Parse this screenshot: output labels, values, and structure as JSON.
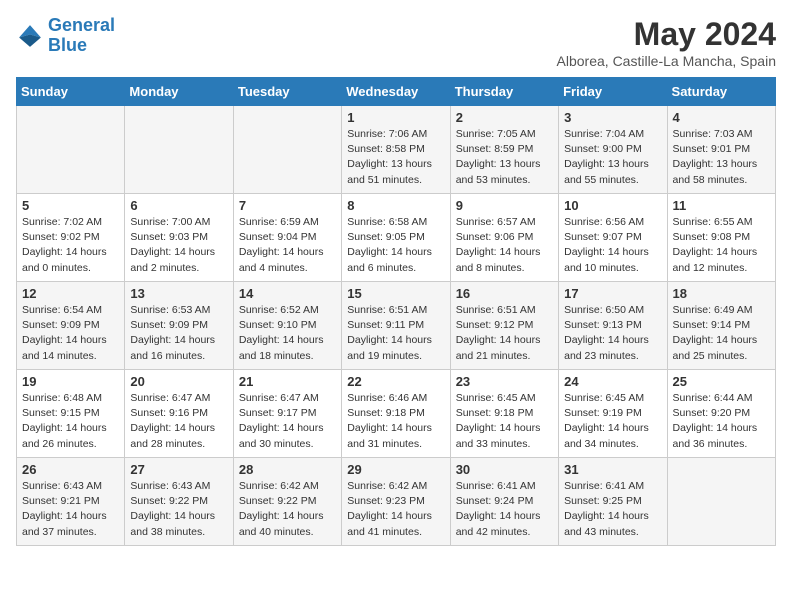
{
  "header": {
    "logo_line1": "General",
    "logo_line2": "Blue",
    "month_title": "May 2024",
    "location": "Alborea, Castille-La Mancha, Spain"
  },
  "days_of_week": [
    "Sunday",
    "Monday",
    "Tuesday",
    "Wednesday",
    "Thursday",
    "Friday",
    "Saturday"
  ],
  "weeks": [
    [
      {
        "day": "",
        "info": ""
      },
      {
        "day": "",
        "info": ""
      },
      {
        "day": "",
        "info": ""
      },
      {
        "day": "1",
        "info": "Sunrise: 7:06 AM\nSunset: 8:58 PM\nDaylight: 13 hours\nand 51 minutes."
      },
      {
        "day": "2",
        "info": "Sunrise: 7:05 AM\nSunset: 8:59 PM\nDaylight: 13 hours\nand 53 minutes."
      },
      {
        "day": "3",
        "info": "Sunrise: 7:04 AM\nSunset: 9:00 PM\nDaylight: 13 hours\nand 55 minutes."
      },
      {
        "day": "4",
        "info": "Sunrise: 7:03 AM\nSunset: 9:01 PM\nDaylight: 13 hours\nand 58 minutes."
      }
    ],
    [
      {
        "day": "5",
        "info": "Sunrise: 7:02 AM\nSunset: 9:02 PM\nDaylight: 14 hours\nand 0 minutes."
      },
      {
        "day": "6",
        "info": "Sunrise: 7:00 AM\nSunset: 9:03 PM\nDaylight: 14 hours\nand 2 minutes."
      },
      {
        "day": "7",
        "info": "Sunrise: 6:59 AM\nSunset: 9:04 PM\nDaylight: 14 hours\nand 4 minutes."
      },
      {
        "day": "8",
        "info": "Sunrise: 6:58 AM\nSunset: 9:05 PM\nDaylight: 14 hours\nand 6 minutes."
      },
      {
        "day": "9",
        "info": "Sunrise: 6:57 AM\nSunset: 9:06 PM\nDaylight: 14 hours\nand 8 minutes."
      },
      {
        "day": "10",
        "info": "Sunrise: 6:56 AM\nSunset: 9:07 PM\nDaylight: 14 hours\nand 10 minutes."
      },
      {
        "day": "11",
        "info": "Sunrise: 6:55 AM\nSunset: 9:08 PM\nDaylight: 14 hours\nand 12 minutes."
      }
    ],
    [
      {
        "day": "12",
        "info": "Sunrise: 6:54 AM\nSunset: 9:09 PM\nDaylight: 14 hours\nand 14 minutes."
      },
      {
        "day": "13",
        "info": "Sunrise: 6:53 AM\nSunset: 9:09 PM\nDaylight: 14 hours\nand 16 minutes."
      },
      {
        "day": "14",
        "info": "Sunrise: 6:52 AM\nSunset: 9:10 PM\nDaylight: 14 hours\nand 18 minutes."
      },
      {
        "day": "15",
        "info": "Sunrise: 6:51 AM\nSunset: 9:11 PM\nDaylight: 14 hours\nand 19 minutes."
      },
      {
        "day": "16",
        "info": "Sunrise: 6:51 AM\nSunset: 9:12 PM\nDaylight: 14 hours\nand 21 minutes."
      },
      {
        "day": "17",
        "info": "Sunrise: 6:50 AM\nSunset: 9:13 PM\nDaylight: 14 hours\nand 23 minutes."
      },
      {
        "day": "18",
        "info": "Sunrise: 6:49 AM\nSunset: 9:14 PM\nDaylight: 14 hours\nand 25 minutes."
      }
    ],
    [
      {
        "day": "19",
        "info": "Sunrise: 6:48 AM\nSunset: 9:15 PM\nDaylight: 14 hours\nand 26 minutes."
      },
      {
        "day": "20",
        "info": "Sunrise: 6:47 AM\nSunset: 9:16 PM\nDaylight: 14 hours\nand 28 minutes."
      },
      {
        "day": "21",
        "info": "Sunrise: 6:47 AM\nSunset: 9:17 PM\nDaylight: 14 hours\nand 30 minutes."
      },
      {
        "day": "22",
        "info": "Sunrise: 6:46 AM\nSunset: 9:18 PM\nDaylight: 14 hours\nand 31 minutes."
      },
      {
        "day": "23",
        "info": "Sunrise: 6:45 AM\nSunset: 9:18 PM\nDaylight: 14 hours\nand 33 minutes."
      },
      {
        "day": "24",
        "info": "Sunrise: 6:45 AM\nSunset: 9:19 PM\nDaylight: 14 hours\nand 34 minutes."
      },
      {
        "day": "25",
        "info": "Sunrise: 6:44 AM\nSunset: 9:20 PM\nDaylight: 14 hours\nand 36 minutes."
      }
    ],
    [
      {
        "day": "26",
        "info": "Sunrise: 6:43 AM\nSunset: 9:21 PM\nDaylight: 14 hours\nand 37 minutes."
      },
      {
        "day": "27",
        "info": "Sunrise: 6:43 AM\nSunset: 9:22 PM\nDaylight: 14 hours\nand 38 minutes."
      },
      {
        "day": "28",
        "info": "Sunrise: 6:42 AM\nSunset: 9:22 PM\nDaylight: 14 hours\nand 40 minutes."
      },
      {
        "day": "29",
        "info": "Sunrise: 6:42 AM\nSunset: 9:23 PM\nDaylight: 14 hours\nand 41 minutes."
      },
      {
        "day": "30",
        "info": "Sunrise: 6:41 AM\nSunset: 9:24 PM\nDaylight: 14 hours\nand 42 minutes."
      },
      {
        "day": "31",
        "info": "Sunrise: 6:41 AM\nSunset: 9:25 PM\nDaylight: 14 hours\nand 43 minutes."
      },
      {
        "day": "",
        "info": ""
      }
    ]
  ]
}
